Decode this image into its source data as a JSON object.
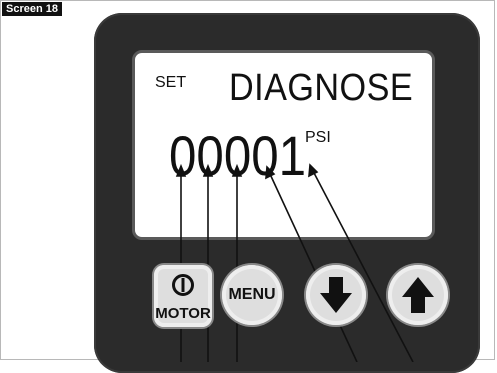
{
  "figure_label": "Screen 18",
  "display": {
    "set_label": "SET",
    "title": "DIAGNOSE",
    "value": "00001",
    "unit": "PSI"
  },
  "buttons": {
    "motor": {
      "label": "MOTOR",
      "icon": "power-icon"
    },
    "menu": {
      "label": "MENU"
    },
    "down": {
      "icon": "arrow-down-icon"
    },
    "up": {
      "icon": "arrow-up-icon"
    }
  },
  "colors": {
    "device_body": "#2b2b2b",
    "lcd_background": "#ffffff",
    "button_face": "#dedede"
  }
}
